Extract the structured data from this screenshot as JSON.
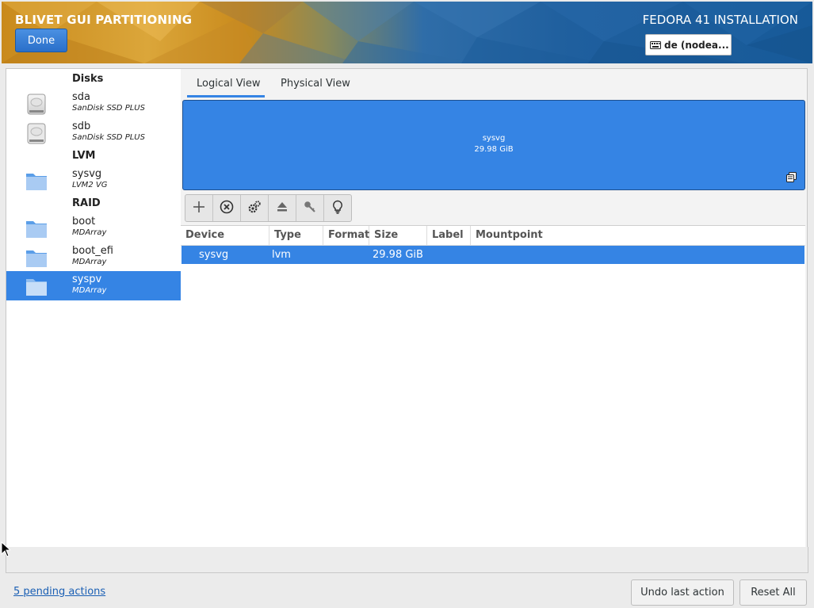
{
  "header": {
    "app_title": "BLIVET GUI PARTITIONING",
    "done_label": "Done",
    "product_title": "FEDORA 41 INSTALLATION",
    "keyboard_layout": "de (nodea..."
  },
  "sidebar": {
    "groups": {
      "disks": "Disks",
      "lvm": "LVM",
      "raid": "RAID"
    },
    "devices": [
      {
        "name": "sda",
        "sub": "SanDisk SSD PLUS",
        "icon": "hard-disk-icon"
      },
      {
        "name": "sdb",
        "sub": "SanDisk SSD PLUS",
        "icon": "hard-disk-icon"
      },
      {
        "name": "sysvg",
        "sub": "LVM2 VG",
        "icon": "folder-icon"
      },
      {
        "name": "boot",
        "sub": "MDArray",
        "icon": "folder-icon"
      },
      {
        "name": "boot_efi",
        "sub": "MDArray",
        "icon": "folder-icon"
      },
      {
        "name": "syspv",
        "sub": "MDArray",
        "icon": "folder-icon"
      }
    ]
  },
  "main": {
    "tabs": [
      {
        "label": "Logical View",
        "active": true
      },
      {
        "label": "Physical View",
        "active": false
      }
    ],
    "visual": {
      "name": "sysvg",
      "size": "29.98 GiB"
    },
    "toolbar": [
      "add-icon",
      "delete-icon",
      "edit-settings-icon",
      "eject-icon",
      "key-icon",
      "lightbulb-icon"
    ],
    "table": {
      "columns": [
        "Device",
        "Type",
        "Format",
        "Size",
        "Label",
        "Mountpoint"
      ],
      "rows": [
        {
          "device": "sysvg",
          "type": "lvm",
          "format": "",
          "size": "29.98 GiB",
          "label": "",
          "mountpoint": ""
        }
      ]
    }
  },
  "footer": {
    "pending_actions": "5 pending actions",
    "undo_label": "Undo last action",
    "reset_label": "Reset All"
  },
  "colors": {
    "accent": "#3584e4",
    "header_blue": "#1f5f9e",
    "header_orange": "#d59a2b"
  }
}
